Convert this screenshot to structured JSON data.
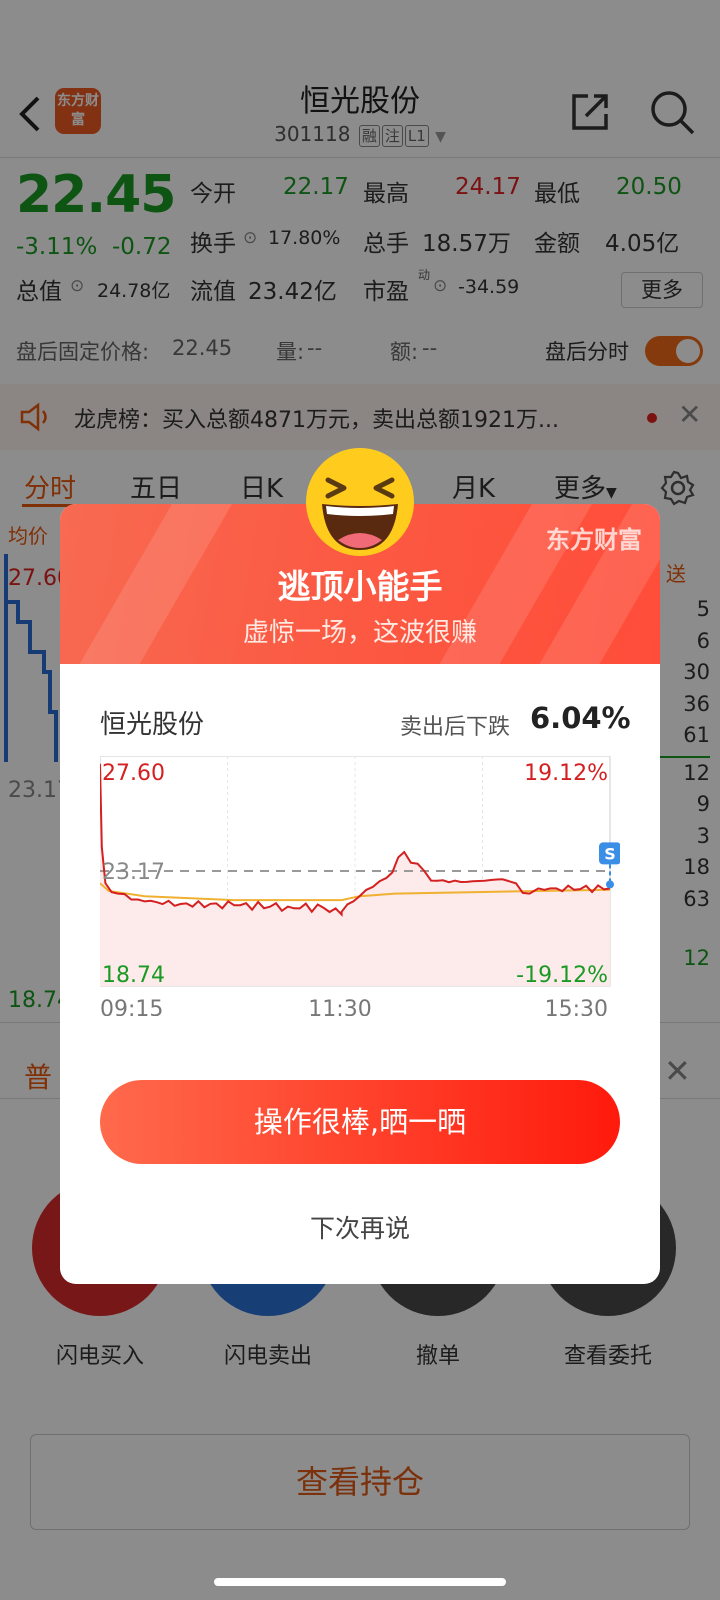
{
  "header": {
    "title": "恒光股份",
    "code": "301118",
    "tags": [
      "融",
      "注",
      "L1"
    ],
    "logo_text": "东方财富"
  },
  "quote": {
    "price": "22.45",
    "change_pct": "-3.11%",
    "change_amt": "-0.72",
    "fields": {
      "open_label": "今开",
      "open": "22.17",
      "high_label": "最高",
      "high": "24.17",
      "low_label": "最低",
      "low": "20.50",
      "turnover_label": "换手",
      "turnover": "17.80%",
      "volume_label": "总手",
      "volume": "18.57万",
      "amount_label": "金额",
      "amount": "4.05亿",
      "mktcap_label": "总值",
      "mktcap": "24.78亿",
      "float_label": "流值",
      "float": "23.42亿",
      "pe_label": "市盈",
      "pe_sup": "动",
      "pe": "-34.59"
    },
    "more_label": "更多"
  },
  "afterhours": {
    "price_label": "盘后固定价格:",
    "price": "22.45",
    "vol_label": "量:",
    "vol": "--",
    "amt_label": "额:",
    "amt": "--",
    "toggle_label": "盘后分时"
  },
  "notice": {
    "text": "龙虎榜：买入总额4871万元，卖出总额1921万..."
  },
  "tabs": [
    "分时",
    "五日",
    "日K",
    "月K",
    "更多"
  ],
  "bg_chart": {
    "avg_label": "均价",
    "top": "27.60",
    "mid": "23.17",
    "bot": "18.74",
    "right_label": "送",
    "right_nums": [
      "5",
      "6",
      "30",
      "36",
      "61",
      "12",
      "9",
      "3",
      "18",
      "63",
      "12"
    ]
  },
  "bottom": {
    "type_label": "普",
    "actions": [
      "闪电买入",
      "闪电卖出",
      "撤单",
      "查看委托"
    ],
    "hold_label": "查看持仓"
  },
  "modal": {
    "brand": "东方财富",
    "title": "逃顶小能手",
    "subtitle": "虚惊一场，这波很赚",
    "stock": "恒光股份",
    "drop_label": "卖出后下跌",
    "drop_value": "6.04%",
    "share_button": "操作很棒,晒一晒",
    "later": "下次再说",
    "chart": {
      "left_top": "27.60",
      "left_mid": "23.17",
      "left_bot": "18.74",
      "right_top": "19.12%",
      "right_bot": "-19.12%",
      "times": [
        "09:15",
        "11:30",
        "15:30"
      ],
      "marker": "S"
    }
  },
  "chart_data": {
    "type": "line",
    "ylim": [
      18.74,
      27.6
    ],
    "reference": 23.17,
    "series": [
      {
        "x": [
          "09:15",
          "09:16",
          "09:18",
          "09:25",
          "09:40",
          "10:00",
          "10:30",
          "11:00",
          "11:20",
          "11:30",
          "13:00",
          "13:10",
          "13:25",
          "13:35",
          "13:50",
          "14:10",
          "14:30",
          "14:45",
          "14:50",
          "15:00",
          "15:30"
        ],
        "values": [
          27.3,
          24.1,
          22.7,
          22.3,
          22.0,
          21.9,
          21.85,
          21.8,
          21.75,
          21.5,
          21.6,
          22.2,
          22.9,
          23.9,
          22.8,
          22.75,
          22.85,
          22.3,
          22.5,
          22.5,
          22.5
        ]
      },
      {
        "x": [
          "09:15",
          "09:20",
          "09:40",
          "10:30",
          "11:30",
          "13:10",
          "13:30",
          "15:30"
        ],
        "values": [
          22.7,
          22.4,
          22.2,
          22.05,
          22.05,
          22.2,
          22.3,
          22.45
        ]
      }
    ]
  }
}
